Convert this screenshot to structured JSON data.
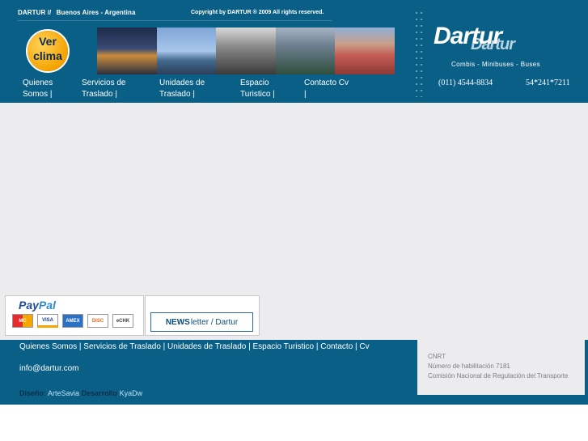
{
  "header": {
    "brand_short": "DARTUR //",
    "city": "Buenos Aires - Argentina",
    "copyright": "Copyright by DARTUR ® 2009 All rights reserved.",
    "weather_line1": "Ver",
    "weather_line2": "clima",
    "nav": [
      {
        "line1": "Quienes",
        "line2": "Somos |"
      },
      {
        "line1": "Servicios de",
        "line2": "Traslado |"
      },
      {
        "line1": "Unidades de",
        "line2": "Traslado |"
      },
      {
        "line1": "Espacio",
        "line2": "Turistico |"
      },
      {
        "line1": "Contacto  Cv",
        "line2": "|"
      }
    ],
    "brand": "Dartur",
    "tagline": "Combis - Minibuses - Buses",
    "phone1": "(011) 4544-8834",
    "phone2": "54*241*7211"
  },
  "paypal": {
    "logo_main": "Pay",
    "logo_accent": "Pal",
    "cards": [
      "MC",
      "VISA",
      "AMEX",
      "DISC",
      "eCHK"
    ]
  },
  "newsletter": {
    "bold": "NEWS",
    "rest": "letter / Dartur"
  },
  "footer": {
    "nav": "Quienes Somos | Servicios de Traslado | Unidades de Traslado | Espacio Turistico | Contacto | Cv",
    "email": "info@dartur.com",
    "credits_label1": "Diseño:",
    "credits_link1": "ArteSavia",
    "credits_label2": "Desarrollo",
    "credits_link2": "KyaDw",
    "cnrt": {
      "line1": "CNRT",
      "line2": "Número de habilitación 7181",
      "line3": "Comisión Nacional de Regulación del Transporte"
    }
  },
  "colors": {
    "header_blue": "#0a5f86",
    "content_gray": "#ececee"
  }
}
